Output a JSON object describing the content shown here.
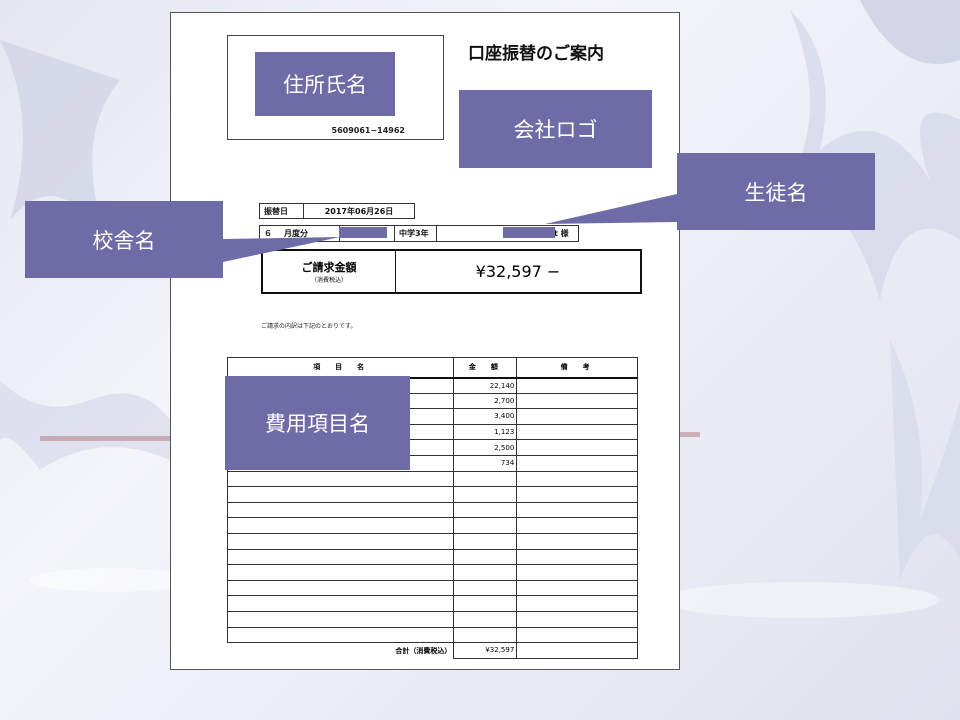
{
  "document": {
    "title": "口座振替のご案内",
    "account_code": "5609061−14962",
    "transfer_date_label": "振替日",
    "transfer_date": "2017年06月26日",
    "month": "６",
    "month_suffix": "月度分",
    "grade": "中学3年",
    "honorific_partial": "t 様",
    "billing_label": "ご請求金額",
    "tax_note": "（消費税込）",
    "billing_amount": "¥32,597 −",
    "intro_note": "ご請求の内訳は下記のとおりです。",
    "table": {
      "headers": [
        "項　目　名",
        "金　額",
        "備　考"
      ],
      "amounts": [
        "22,140",
        "2,700",
        "3,400",
        "1,123",
        "2,500",
        "734"
      ],
      "empty_rows": 11,
      "total_label": "合計（消費税込）",
      "total_value": "¥32,597"
    }
  },
  "callouts": {
    "address_name": "住所氏名",
    "company_logo": "会社ロゴ",
    "student_name": "生徒名",
    "school_name": "校舎名",
    "expense_item_name": "費用項目名"
  },
  "colors": {
    "callout": "#6f6ba7",
    "page_bg": "#ffffff"
  }
}
